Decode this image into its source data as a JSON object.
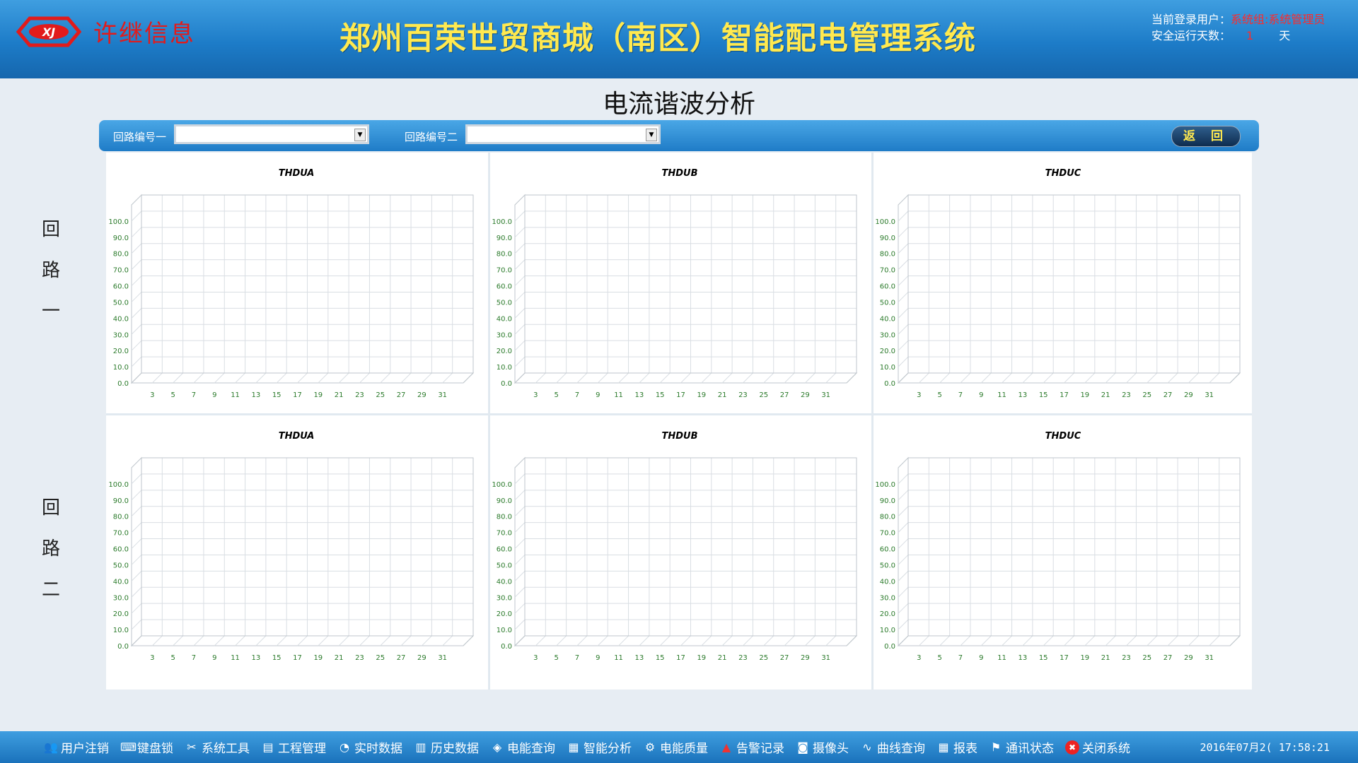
{
  "header": {
    "logo_text": "许继信息",
    "system_title": "郑州百荣世贸商城（南区）智能配电管理系统",
    "current_user_label": "当前登录用户：",
    "current_user_value": "系统组:系统管理员",
    "safe_days_label": "安全运行天数：",
    "safe_days_value": "1",
    "safe_days_unit": "天"
  },
  "page_title": "电流谐波分析",
  "toolbar": {
    "loop1_label": "回路编号一",
    "loop1_value": "",
    "loop2_label": "回路编号二",
    "loop2_value": "",
    "back_label": "返 回"
  },
  "side_labels": {
    "loop1": [
      "回",
      "路",
      "一"
    ],
    "loop2": [
      "回",
      "路",
      "二"
    ]
  },
  "chart_data": [
    {
      "type": "bar",
      "title": "THDUA",
      "loop": "回路一",
      "categories": [
        3,
        5,
        7,
        9,
        11,
        13,
        15,
        17,
        19,
        21,
        23,
        25,
        27,
        29,
        31
      ],
      "values": [],
      "yticks": [
        "0.0",
        "10.0",
        "20.0",
        "30.0",
        "40.0",
        "50.0",
        "60.0",
        "70.0",
        "80.0",
        "90.0",
        "100.0"
      ],
      "ylim": [
        0,
        100
      ],
      "grid": true
    },
    {
      "type": "bar",
      "title": "THDUB",
      "loop": "回路一",
      "categories": [
        3,
        5,
        7,
        9,
        11,
        13,
        15,
        17,
        19,
        21,
        23,
        25,
        27,
        29,
        31
      ],
      "values": [],
      "yticks": [
        "0.0",
        "10.0",
        "20.0",
        "30.0",
        "40.0",
        "50.0",
        "60.0",
        "70.0",
        "80.0",
        "90.0",
        "100.0"
      ],
      "ylim": [
        0,
        100
      ],
      "grid": true
    },
    {
      "type": "bar",
      "title": "THDUC",
      "loop": "回路一",
      "categories": [
        3,
        5,
        7,
        9,
        11,
        13,
        15,
        17,
        19,
        21,
        23,
        25,
        27,
        29,
        31
      ],
      "values": [],
      "yticks": [
        "0.0",
        "10.0",
        "20.0",
        "30.0",
        "40.0",
        "50.0",
        "60.0",
        "70.0",
        "80.0",
        "90.0",
        "100.0"
      ],
      "ylim": [
        0,
        100
      ],
      "grid": true
    },
    {
      "type": "bar",
      "title": "THDUA",
      "loop": "回路二",
      "categories": [
        3,
        5,
        7,
        9,
        11,
        13,
        15,
        17,
        19,
        21,
        23,
        25,
        27,
        29,
        31
      ],
      "values": [],
      "yticks": [
        "0.0",
        "10.0",
        "20.0",
        "30.0",
        "40.0",
        "50.0",
        "60.0",
        "70.0",
        "80.0",
        "90.0",
        "100.0"
      ],
      "ylim": [
        0,
        100
      ],
      "grid": true
    },
    {
      "type": "bar",
      "title": "THDUB",
      "loop": "回路二",
      "categories": [
        3,
        5,
        7,
        9,
        11,
        13,
        15,
        17,
        19,
        21,
        23,
        25,
        27,
        29,
        31
      ],
      "values": [],
      "yticks": [
        "0.0",
        "10.0",
        "20.0",
        "30.0",
        "40.0",
        "50.0",
        "60.0",
        "70.0",
        "80.0",
        "90.0",
        "100.0"
      ],
      "ylim": [
        0,
        100
      ],
      "grid": true
    },
    {
      "type": "bar",
      "title": "THDUC",
      "loop": "回路二",
      "categories": [
        3,
        5,
        7,
        9,
        11,
        13,
        15,
        17,
        19,
        21,
        23,
        25,
        27,
        29,
        31
      ],
      "values": [],
      "yticks": [
        "0.0",
        "10.0",
        "20.0",
        "30.0",
        "40.0",
        "50.0",
        "60.0",
        "70.0",
        "80.0",
        "90.0",
        "100.0"
      ],
      "ylim": [
        0,
        100
      ],
      "grid": true
    }
  ],
  "footer": {
    "menu": [
      {
        "label": "用户注销",
        "icon": "users-icon"
      },
      {
        "label": "键盘锁",
        "icon": "keyboard-icon"
      },
      {
        "label": "系统工具",
        "icon": "tools-icon"
      },
      {
        "label": "工程管理",
        "icon": "project-icon"
      },
      {
        "label": "实时数据",
        "icon": "realtime-icon"
      },
      {
        "label": "历史数据",
        "icon": "history-icon"
      },
      {
        "label": "电能查询",
        "icon": "energy-query-icon"
      },
      {
        "label": "智能分析",
        "icon": "analysis-icon"
      },
      {
        "label": "电能质量",
        "icon": "quality-icon"
      },
      {
        "label": "告警记录",
        "icon": "alarm-icon"
      },
      {
        "label": "摄像头",
        "icon": "camera-icon"
      },
      {
        "label": "曲线查询",
        "icon": "curve-icon"
      },
      {
        "label": "报表",
        "icon": "report-icon"
      },
      {
        "label": "通讯状态",
        "icon": "network-icon"
      },
      {
        "label": "关闭系统",
        "icon": "close-icon"
      }
    ],
    "clock": "2016年07月2( 17:58:21"
  },
  "colors": {
    "header_blue": "#1d7cc8",
    "title_yellow": "#ffe94f",
    "logo_red": "#e21b1b",
    "axis_green": "#2a7a2a"
  }
}
